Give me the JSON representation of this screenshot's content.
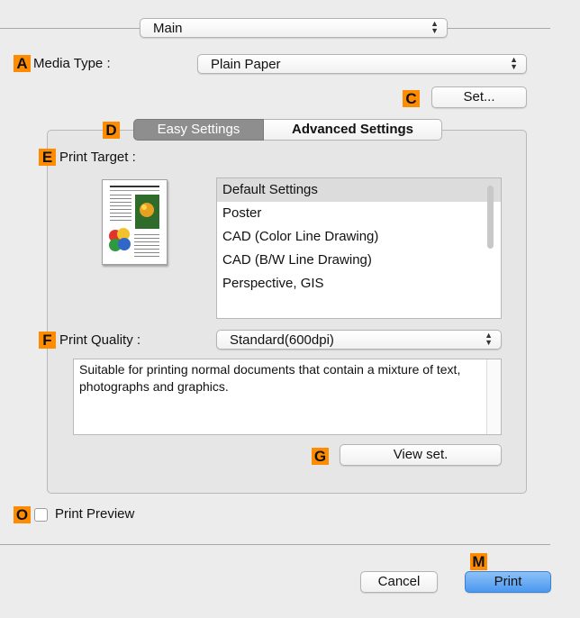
{
  "main_popup": {
    "value": "Main"
  },
  "media_type": {
    "badge": "A",
    "label": "Media Type :",
    "value": "Plain Paper"
  },
  "set_button": {
    "badge": "C",
    "label": "Set..."
  },
  "tabs": {
    "badge": "D",
    "items": [
      {
        "label": "Easy Settings",
        "selected": true
      },
      {
        "label": "Advanced Settings",
        "selected": false
      }
    ]
  },
  "print_target": {
    "badge": "E",
    "label": "Print Target :",
    "items": [
      "Default Settings",
      "Poster",
      "CAD (Color Line Drawing)",
      "CAD (B/W Line Drawing)",
      "Perspective, GIS"
    ],
    "selected_index": 0
  },
  "print_quality": {
    "badge": "F",
    "label": "Print Quality :",
    "value": "Standard(600dpi)",
    "description": "Suitable for printing normal documents that contain a mixture of text, photographs and graphics."
  },
  "view_set_button": {
    "badge": "G",
    "label": "View set."
  },
  "print_preview": {
    "badge": "O",
    "label": "Print Preview",
    "checked": false
  },
  "footer": {
    "badge": "M",
    "cancel_label": "Cancel",
    "print_label": "Print"
  },
  "colors": {
    "badge": "#ff8c00",
    "primary_button": "#4a98f0",
    "selected_tab": "#8e8e8e"
  }
}
